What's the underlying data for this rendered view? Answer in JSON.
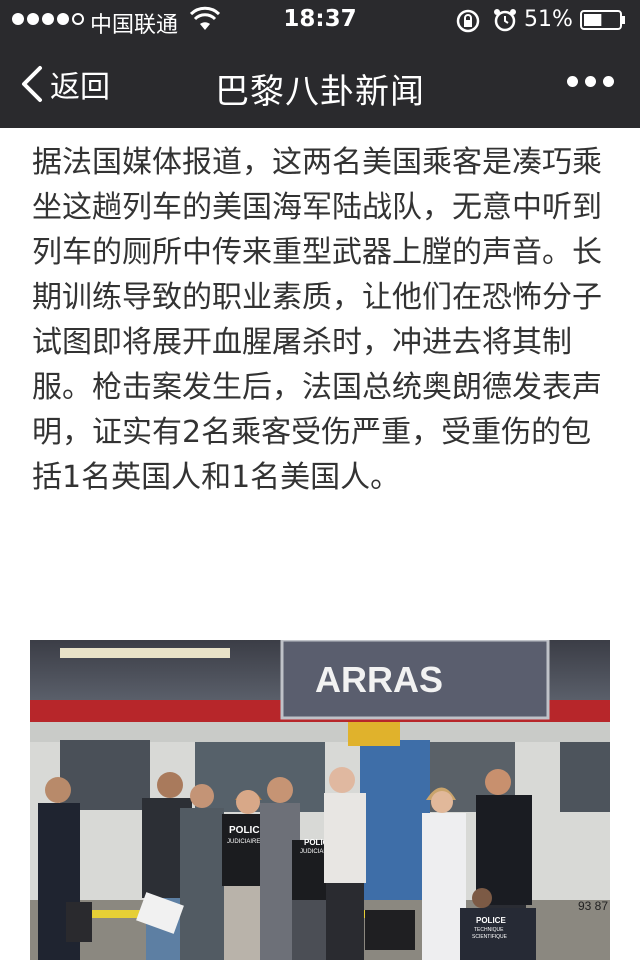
{
  "status_bar": {
    "carrier": "中国联通",
    "time": "18:37",
    "battery_percent": "51%",
    "signal_bars_filled": 4,
    "signal_bars_total": 5,
    "battery_level": 0.51
  },
  "nav": {
    "back_label": "返回",
    "title": "巴黎八卦新闻",
    "back_icon": "chevron-left-icon",
    "more_icon": "more-dots-icon"
  },
  "article": {
    "paragraph": "据法国媒体报道，这两名美国乘客是凑巧乘坐这趟列车的美国海军陆战队，无意中听到列车的厕所中传来重型武器上膛的声音。长期训练导致的职业素质，让他们在恐怖分子试图即将展开血腥屠杀时，冲进去将其制服。枪击案发生后，法国总统奥朗德发表声明，证实有2名乘客受伤严重，受重伤的包括1名英国人和1名美国人。"
  },
  "photo": {
    "station_sign": "ARRAS",
    "vest_label_1_line1": "POLICE",
    "vest_label_1_line2": "JUDICIAIRE",
    "vest_label_2_line1": "POLICE",
    "vest_label_2_line2": "JUDICIAIRE",
    "vest_label_3_line1": "POLICE",
    "vest_label_3_line2": "TECHNIQUE",
    "vest_label_3_line3": "SCIENTIFIQUE",
    "train_number": "93 87"
  },
  "colors": {
    "topbar_bg": "#2a2a2d",
    "article_text": "#333333",
    "sign_bg": "#5a5e6e"
  }
}
